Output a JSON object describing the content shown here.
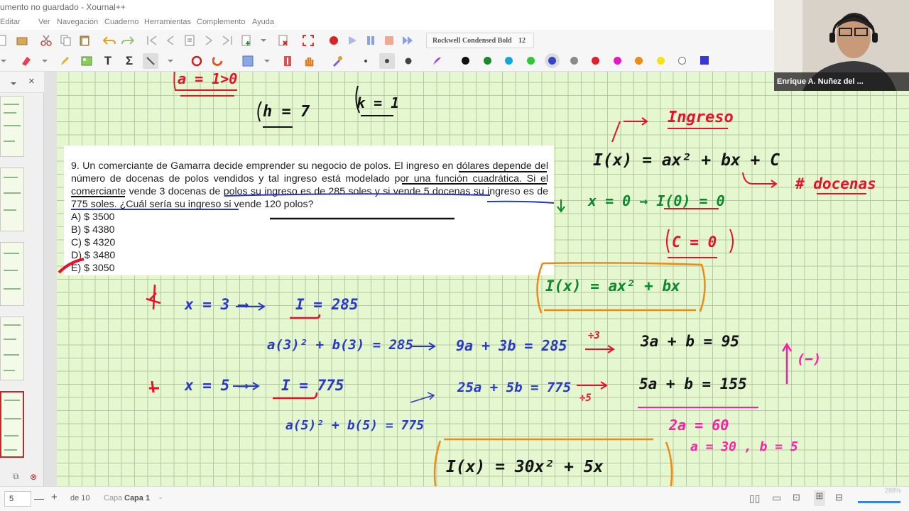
{
  "window": {
    "title": "umento no guardado - Xournal++"
  },
  "menu": [
    "Editar",
    "Ver",
    "Navegación",
    "Cuaderno",
    "Herramientas",
    "Complemento",
    "Ayuda"
  ],
  "toolbar": {
    "font_name": "Rockwell Condensed Bold",
    "font_size": "12"
  },
  "palette": [
    "#111111",
    "#1a8a2a",
    "#15a6de",
    "#2cc83a",
    "#3445c8",
    "#8a8a8a",
    "#e0202a",
    "#e818c8",
    "#f08a14",
    "#f2e21a",
    "#ffffff",
    "#3a36d8"
  ],
  "webcam": {
    "name": "Enrique A. Nuñez del ..."
  },
  "problem": {
    "text": "9. Un comerciante de Gamarra decide emprender su negocio de polos. El ingreso en dólares depende del número de docenas de polos vendidos y tal ingreso está modelado por una función cuadrática. Si el comerciante vende 3 docenas de polos su ingreso es de 285 soles y si vende 5 docenas su ingreso es de 775 soles. ¿Cuál sería su ingreso si vende 120 polos?",
    "options": [
      "A) $ 3500",
      "B) $ 4380",
      "C) $ 4320",
      "D) $ 3480",
      "E) $ 3050"
    ]
  },
  "notes": {
    "a_cond": "a = 1>0",
    "h_box": "h = 7",
    "k_box": "k = 1",
    "ingreso": "Ingreso",
    "formula": "I(x) = ax² + bx + C",
    "docenas": "# docenas",
    "x0": "x = 0  →  I(0) = 0",
    "c0": "C = 0",
    "formula2": "I(x) = ax² + bx",
    "x3": "x = 3  ⟶",
    "i285": "I = 285",
    "sub3": "a(3)² + b(3) = 285",
    "eq1": "9a + 3b = 285",
    "div3": "÷3",
    "eq1r": "3a + b = 95",
    "x5": "x = 5  ⟶",
    "i775": "I = 775",
    "sub5": "a(5)² + b(5) = 775",
    "eq2": "25a + 5b = 775",
    "div5": "÷5",
    "eq2r": "5a + b = 155",
    "minus": "(−)",
    "twoa": "2a = 60",
    "ab": "a = 30 ,  b = 5",
    "final": "I(x) = 30x² + 5x"
  },
  "statusbar": {
    "page": "5",
    "of_pages": "de 10",
    "layer_label": "Capa",
    "layer_value": "Capa 1",
    "zoom": "288%"
  }
}
